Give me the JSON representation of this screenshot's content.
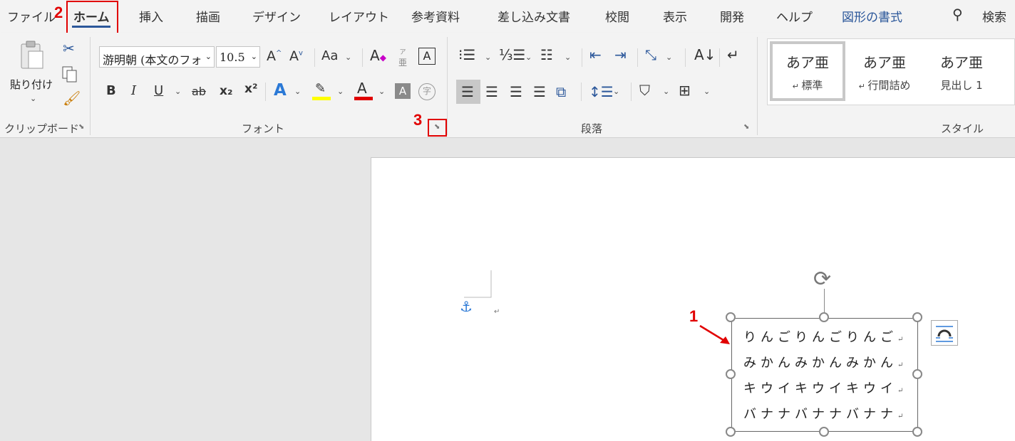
{
  "tabs": [
    {
      "label": "ファイル",
      "active": false
    },
    {
      "label": "ホーム",
      "active": true
    },
    {
      "label": "挿入",
      "active": false
    },
    {
      "label": "描画",
      "active": false
    },
    {
      "label": "デザイン",
      "active": false
    },
    {
      "label": "レイアウト",
      "active": false
    },
    {
      "label": "参考資料",
      "active": false
    },
    {
      "label": "差し込み文書",
      "active": false
    },
    {
      "label": "校閲",
      "active": false
    },
    {
      "label": "表示",
      "active": false
    },
    {
      "label": "開発",
      "active": false
    },
    {
      "label": "ヘルプ",
      "active": false
    },
    {
      "label": "図形の書式",
      "active": false
    }
  ],
  "search_label": "検索",
  "clipboard": {
    "paste_label": "貼り付け",
    "group_label": "クリップボード"
  },
  "font": {
    "font_name": "游明朝 (本文のフォ",
    "font_size": "10.5",
    "change_case": "Aa",
    "phonetic_top": "ア",
    "phonetic_bottom": "亜",
    "enclose_char": "A",
    "bold": "B",
    "italic": "I",
    "underline": "U",
    "strike": "ab",
    "subscript": "x₂",
    "superscript": "x²",
    "text_effect": "A",
    "font_color": "A",
    "char_shading": "A",
    "enclosed_char": "字",
    "group_label": "フォント"
  },
  "paragraph": {
    "group_label": "段落"
  },
  "styles": {
    "items": [
      {
        "sample": "あア亜",
        "name": "標準",
        "selected": true
      },
      {
        "sample": "あア亜",
        "name": "行間詰め",
        "selected": false
      },
      {
        "sample": "あア亜",
        "name": "見出し 1",
        "selected": false
      }
    ],
    "group_label": "スタイル"
  },
  "annotations": [
    "1",
    "2",
    "3"
  ],
  "textbox_lines": [
    "りんごりんごりんご",
    "みかんみかんみかん",
    "キウイキウイキウイ",
    "バナナバナナバナナ"
  ],
  "colors": {
    "accent": "#2b579a",
    "annotation_red": "#e10000",
    "highlight": "#ffff00",
    "font_color_bar": "#e00000"
  }
}
